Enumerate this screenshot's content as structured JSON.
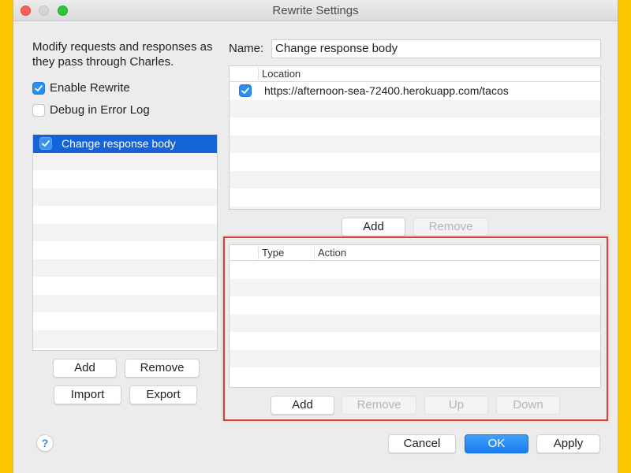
{
  "window": {
    "title": "Rewrite Settings"
  },
  "left": {
    "description": "Modify requests and responses as they pass through Charles.",
    "enable_rewrite": {
      "label": "Enable Rewrite",
      "checked": true
    },
    "debug_log": {
      "label": "Debug in Error Log",
      "checked": false
    },
    "rule_sets": [
      {
        "label": "Change response body",
        "checked": true,
        "selected": true
      }
    ],
    "buttons": {
      "add": "Add",
      "remove": "Remove",
      "import": "Import",
      "export": "Export"
    },
    "help": "?"
  },
  "right": {
    "name_label": "Name:",
    "name_value": "Change response body",
    "locations": {
      "columns": [
        "",
        "Location"
      ],
      "rows": [
        {
          "checked": true,
          "location": "https://afternoon-sea-72400.herokuapp.com/tacos"
        }
      ],
      "buttons": {
        "add": "Add",
        "remove": "Remove"
      }
    },
    "rules": {
      "columns": [
        "",
        "Type",
        "Action"
      ],
      "rows": [],
      "buttons": {
        "add": "Add",
        "remove": "Remove",
        "up": "Up",
        "down": "Down"
      }
    }
  },
  "footer": {
    "cancel": "Cancel",
    "ok": "OK",
    "apply": "Apply"
  },
  "colors": {
    "background": "#FDC800",
    "accent": "#1464D8",
    "highlight_border": "#C9473D"
  }
}
